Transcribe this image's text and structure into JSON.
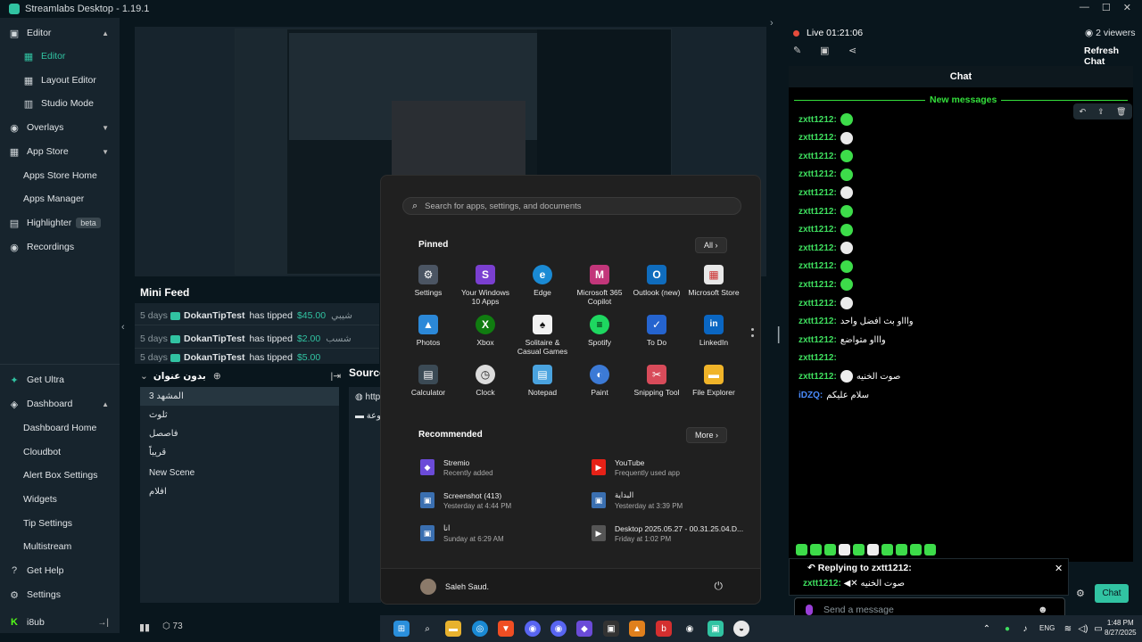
{
  "window": {
    "title": "Streamlabs Desktop - 1.19.1",
    "controls": [
      "—",
      "☐",
      "✕"
    ]
  },
  "sidebar": {
    "items": [
      {
        "label": "Editor",
        "chevron": "▲"
      },
      {
        "label": "Editor"
      },
      {
        "label": "Layout Editor"
      },
      {
        "label": "Studio Mode"
      },
      {
        "label": "Overlays",
        "chevron": "▼"
      },
      {
        "label": "App Store",
        "chevron": "▼"
      },
      {
        "label": "Apps Store Home"
      },
      {
        "label": "Apps Manager"
      },
      {
        "label": "Highlighter",
        "badge": "beta"
      },
      {
        "label": "Recordings"
      },
      {
        "label": "Get Ultra"
      },
      {
        "label": "Dashboard",
        "chevron": "▲"
      },
      {
        "label": "Dashboard Home"
      },
      {
        "label": "Cloudbot"
      },
      {
        "label": "Alert Box Settings"
      },
      {
        "label": "Widgets"
      },
      {
        "label": "Tip Settings"
      },
      {
        "label": "Multistream"
      },
      {
        "label": "Get Help"
      },
      {
        "label": "Settings"
      },
      {
        "label": "i8ub"
      }
    ]
  },
  "minifeed": {
    "title": "Mini Feed",
    "rows": [
      {
        "age": "5 days",
        "user": "DokanTipTest",
        "action": "has tipped",
        "amount": "$45.00",
        "message": "شيبي"
      },
      {
        "age": "5 days",
        "user": "DokanTipTest",
        "action": "has tipped",
        "amount": "$2.00",
        "message": "شسب"
      },
      {
        "age": "5 days",
        "user": "DokanTipTest",
        "action": "has tipped",
        "amount": "$5.00",
        "message": ""
      }
    ]
  },
  "scenes": {
    "title": "بدون عنوان",
    "items": [
      "المشهد 3",
      "ثلوث",
      "فاصصل",
      "قريباً",
      "New Scene",
      "افلام"
    ]
  },
  "sources": {
    "title": "Sources",
    "items": [
      "http",
      "وعة"
    ]
  },
  "bottom": {
    "viewer_count": "73"
  },
  "startmenu": {
    "search_placeholder": "Search for apps, settings, and documents",
    "pinned_heading": "Pinned",
    "all_button": "All",
    "all_chevron": "›",
    "apps": [
      {
        "name": "Settings",
        "color": "#4b5563",
        "glyph": "⚙"
      },
      {
        "name": "Your Windows 10 Apps",
        "color": "#7a3fd0",
        "glyph": "S"
      },
      {
        "name": "Edge",
        "color": "#1a8ad4",
        "glyph": "e"
      },
      {
        "name": "Microsoft 365 Copilot",
        "color": "#c2367a",
        "glyph": "M"
      },
      {
        "name": "Outlook (new)",
        "color": "#0f6cbd",
        "glyph": "O"
      },
      {
        "name": "Microsoft Store",
        "color": "#e8e8e8",
        "glyph": "▦"
      },
      {
        "name": "Photos",
        "color": "#2b88d8",
        "glyph": "▲"
      },
      {
        "name": "Xbox",
        "color": "#107c10",
        "glyph": "X"
      },
      {
        "name": "Solitaire & Casual Games",
        "color": "#1b1b1b",
        "glyph": "♠"
      },
      {
        "name": "Spotify",
        "color": "#1ed760",
        "glyph": "≡"
      },
      {
        "name": "To Do",
        "color": "#2564cf",
        "glyph": "✓"
      },
      {
        "name": "LinkedIn",
        "color": "#0a66c2",
        "glyph": "in"
      },
      {
        "name": "Calculator",
        "color": "#3b4a55",
        "glyph": "▤"
      },
      {
        "name": "Clock",
        "color": "#dcdcdc",
        "glyph": "◷"
      },
      {
        "name": "Notepad",
        "color": "#4aa3df",
        "glyph": "▤"
      },
      {
        "name": "Paint",
        "color": "#3c7ad6",
        "glyph": "◐"
      },
      {
        "name": "Snipping Tool",
        "color": "#d84b5a",
        "glyph": "✂"
      },
      {
        "name": "File Explorer",
        "color": "#f0b429",
        "glyph": "▬"
      }
    ],
    "recommended_heading": "Recommended",
    "more_button": "More",
    "more_chevron": "›",
    "recommended": [
      {
        "name": "Stremio",
        "sub": "Recently added",
        "color": "#6b4bd8",
        "glyph": "◆"
      },
      {
        "name": "YouTube",
        "sub": "Frequently used app",
        "color": "#e62117",
        "glyph": "▶"
      },
      {
        "name": "Screenshot (413)",
        "sub": "Yesterday at 4:44 PM",
        "color": "#3a6fb0",
        "glyph": "▣"
      },
      {
        "name": "البداية",
        "sub": "Yesterday at 3:39 PM",
        "color": "#3a6fb0",
        "glyph": "▣"
      },
      {
        "name": "انا",
        "sub": "Sunday at 6:29 AM",
        "color": "#3a6fb0",
        "glyph": "▣"
      },
      {
        "name": "Desktop 2025.05.27 - 00.31.25.04.D...",
        "sub": "Friday at 1:02 PM",
        "color": "#555",
        "glyph": "▶"
      }
    ],
    "user": "Saleh Saud.",
    "power_glyph": "⏻"
  },
  "chat": {
    "live_label": "Live 01:21:06",
    "viewers": "2 viewers",
    "refresh": "Refresh Chat",
    "title": "Chat",
    "new_messages": "New messages",
    "action_glyphs": [
      "↶",
      "⇪",
      "🗑"
    ],
    "tool_glyphs": [
      "✎",
      "▣",
      "⋖"
    ],
    "messages": [
      {
        "user": "zxtt1212:",
        "text": ""
      },
      {
        "user": "zxtt1212:",
        "text": ""
      },
      {
        "user": "zxtt1212:",
        "text": ""
      },
      {
        "user": "zxtt1212:",
        "text": ""
      },
      {
        "user": "zxtt1212:",
        "text": ""
      },
      {
        "user": "zxtt1212:",
        "text": ""
      },
      {
        "user": "zxtt1212:",
        "text": ""
      },
      {
        "user": "zxtt1212:",
        "text": ""
      },
      {
        "user": "zxtt1212:",
        "text": ""
      },
      {
        "user": "zxtt1212:",
        "text": ""
      },
      {
        "user": "zxtt1212:",
        "text": ""
      },
      {
        "user": "zxtt1212:",
        "text": "واااو بث افضل واحد"
      },
      {
        "user": "zxtt1212:",
        "text": "واااو متواضع"
      },
      {
        "user": "zxtt1212:",
        "text": ""
      },
      {
        "user": "zxtt1212:",
        "text": "صوت الخنيه"
      },
      {
        "user": "iDZQ:",
        "text": "سلام عليكم"
      }
    ],
    "reply_label": "Replying to zxtt1212:",
    "reply_user": "zxtt1212:",
    "reply_text": "صوت الخنيه",
    "input_placeholder": "Send a message",
    "send_label": "Chat"
  },
  "taskbar": {
    "lang": "ENG",
    "time": "1:48 PM",
    "date": "8/27/2025"
  },
  "colors": {
    "accent": "#31c3a2",
    "chat_user": "#3ede5e",
    "live": "#e74c3c"
  }
}
